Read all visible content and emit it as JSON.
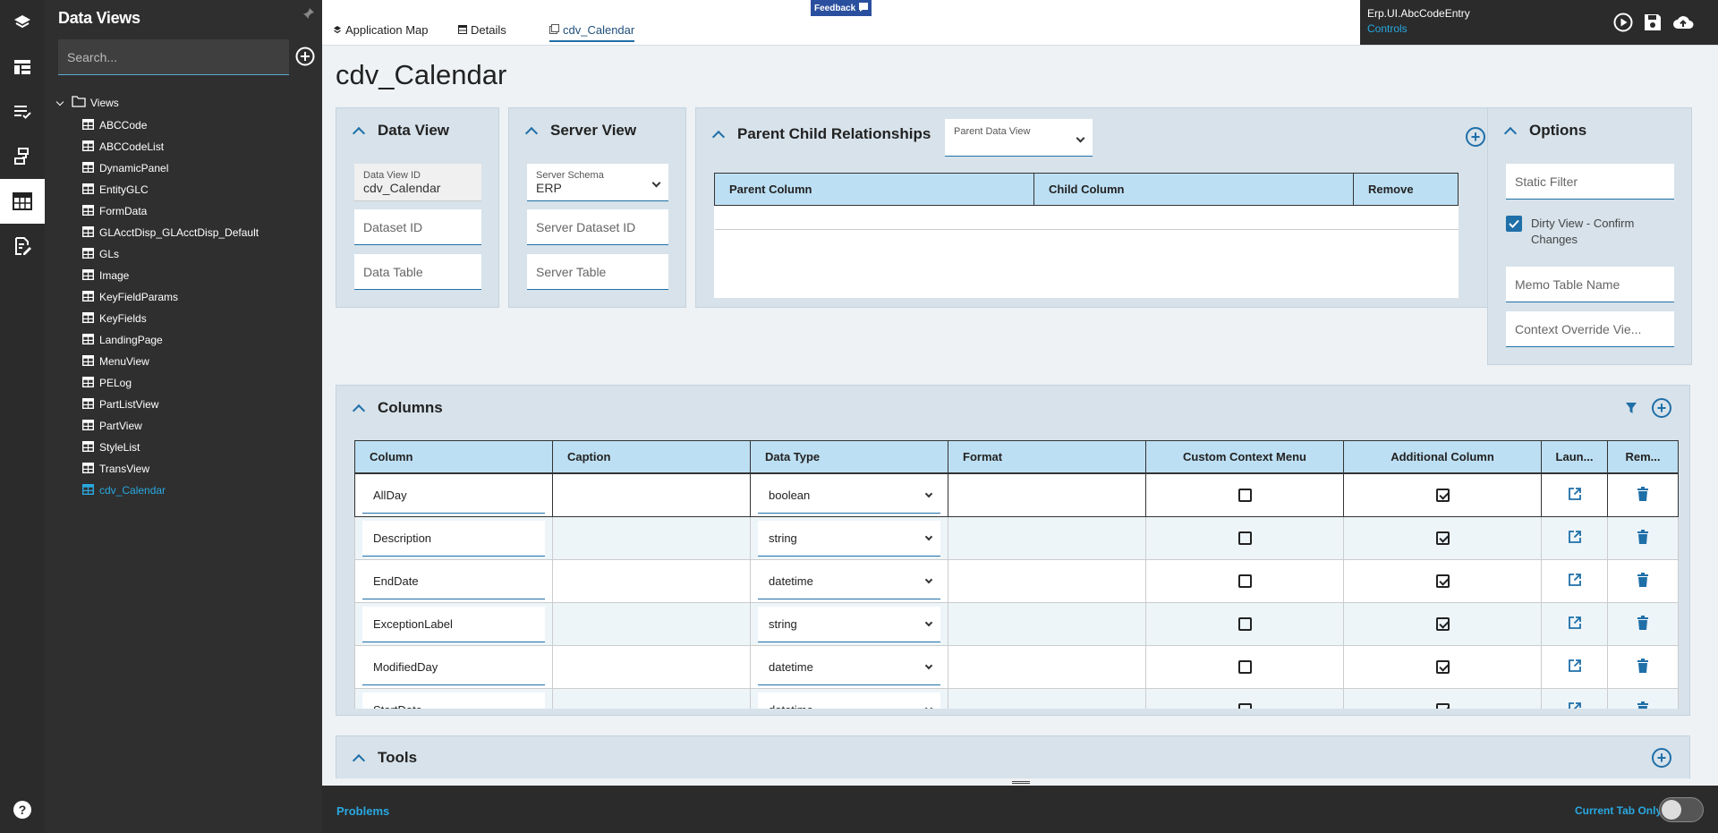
{
  "sidebar": {
    "title": "Data Views",
    "search_placeholder": "Search...",
    "root": "Views",
    "items": [
      "ABCCode",
      "ABCCodeList",
      "DynamicPanel",
      "EntityGLC",
      "FormData",
      "GLAcctDisp_GLAcctDisp_Default",
      "GLs",
      "Image",
      "KeyFieldParams",
      "KeyFields",
      "LandingPage",
      "MenuView",
      "PELog",
      "PartListView",
      "PartView",
      "StyleList",
      "TransView",
      "cdv_Calendar"
    ],
    "selected": "cdv_Calendar"
  },
  "tabs": [
    "Application Map",
    "Details",
    "cdv_Calendar"
  ],
  "feedback_label": "Feedback",
  "context": {
    "title": "Erp.UI.AbcCodeEntry",
    "subtitle": "Controls"
  },
  "page_title": "cdv_Calendar",
  "data_view": {
    "title": "Data View",
    "id_label": "Data View ID",
    "id_value": "cdv_Calendar",
    "dataset_placeholder": "Dataset ID",
    "table_placeholder": "Data Table"
  },
  "server_view": {
    "title": "Server View",
    "schema_label": "Server Schema",
    "schema_value": "ERP",
    "dataset_placeholder": "Server Dataset ID",
    "table_placeholder": "Server Table"
  },
  "pcr": {
    "title": "Parent Child Relationships",
    "parent_dv_label": "Parent Data View",
    "headers": [
      "Parent Column",
      "Child Column",
      "Remove"
    ]
  },
  "options": {
    "title": "Options",
    "static_filter": "Static Filter",
    "dirty_label": "Dirty View - Confirm Changes",
    "dirty_checked": true,
    "memo_table": "Memo Table Name",
    "context_override": "Context Override Vie..."
  },
  "columns": {
    "title": "Columns",
    "headers": [
      "Column",
      "Caption",
      "Data Type",
      "Format",
      "Custom Context Menu",
      "Additional Column",
      "Laun...",
      "Rem..."
    ],
    "rows": [
      {
        "column": "AllDay",
        "caption": "",
        "data_type": "boolean",
        "format": "",
        "custom_context_menu": false,
        "additional_column": true
      },
      {
        "column": "Description",
        "caption": "",
        "data_type": "string",
        "format": "",
        "custom_context_menu": false,
        "additional_column": true
      },
      {
        "column": "EndDate",
        "caption": "",
        "data_type": "datetime",
        "format": "",
        "custom_context_menu": false,
        "additional_column": true
      },
      {
        "column": "ExceptionLabel",
        "caption": "",
        "data_type": "string",
        "format": "",
        "custom_context_menu": false,
        "additional_column": true
      },
      {
        "column": "ModifiedDay",
        "caption": "",
        "data_type": "datetime",
        "format": "",
        "custom_context_menu": false,
        "additional_column": true
      },
      {
        "column": "StartDate",
        "caption": "",
        "data_type": "datetime",
        "format": "",
        "custom_context_menu": false,
        "additional_column": true
      }
    ]
  },
  "tools": {
    "title": "Tools"
  },
  "bottom": {
    "problems": "Problems",
    "current_tab_only": "Current Tab Only"
  },
  "colors": {
    "accent": "#1f6fa8",
    "link": "#29a8e0",
    "dark": "#2b2b2b",
    "header_blue": "#bddff3",
    "panel": "#d7e2ea"
  }
}
